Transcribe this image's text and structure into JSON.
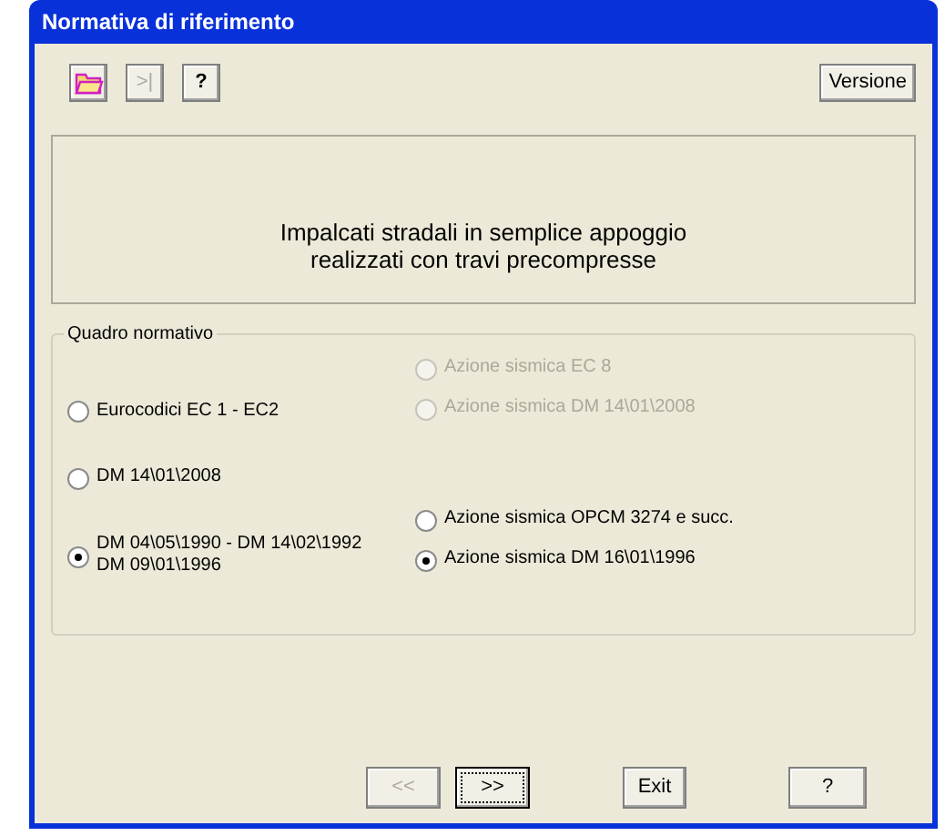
{
  "window": {
    "title": "Normativa di riferimento"
  },
  "toolbar": [
    {
      "kind": "folder",
      "disabled": false
    },
    {
      "kind": "text",
      "label": ">|",
      "disabled": true
    },
    {
      "kind": "text",
      "label": "?",
      "disabled": false
    }
  ],
  "version_button": "Versione",
  "description": [
    "Impalcati stradali in semplice appoggio",
    "realizzati con travi precompresse"
  ],
  "quadro": {
    "title": "Quadro normativo",
    "rows": [
      {
        "main": {
          "lines": [
            "Eurocodici EC 1 - EC2"
          ],
          "selected": false
        },
        "seismic": [
          {
            "label": "Azione sismica EC 8",
            "selected": false,
            "disabled": true
          },
          {
            "label": "Azione sismica DM 14\\01\\2008",
            "selected": false,
            "disabled": true
          }
        ]
      },
      {
        "main": {
          "lines": [
            "DM 14\\01\\2008"
          ],
          "selected": false
        },
        "seismic": []
      },
      {
        "main": {
          "lines": [
            "DM 04\\05\\1990 - DM 14\\02\\1992",
            "DM 09\\01\\1996"
          ],
          "selected": true
        },
        "seismic": [
          {
            "label": "Azione sismica OPCM 3274 e succ.",
            "selected": false,
            "disabled": false
          },
          {
            "label": "Azione sismica DM 16\\01\\1996",
            "selected": true,
            "disabled": false
          }
        ]
      }
    ]
  },
  "footer": [
    {
      "label": "<<",
      "disabled": true,
      "focused": false
    },
    {
      "label": ">>",
      "disabled": false,
      "focused": true
    },
    {
      "label": "Exit",
      "disabled": false,
      "focused": false
    },
    {
      "label": "?",
      "disabled": false,
      "focused": false
    }
  ]
}
